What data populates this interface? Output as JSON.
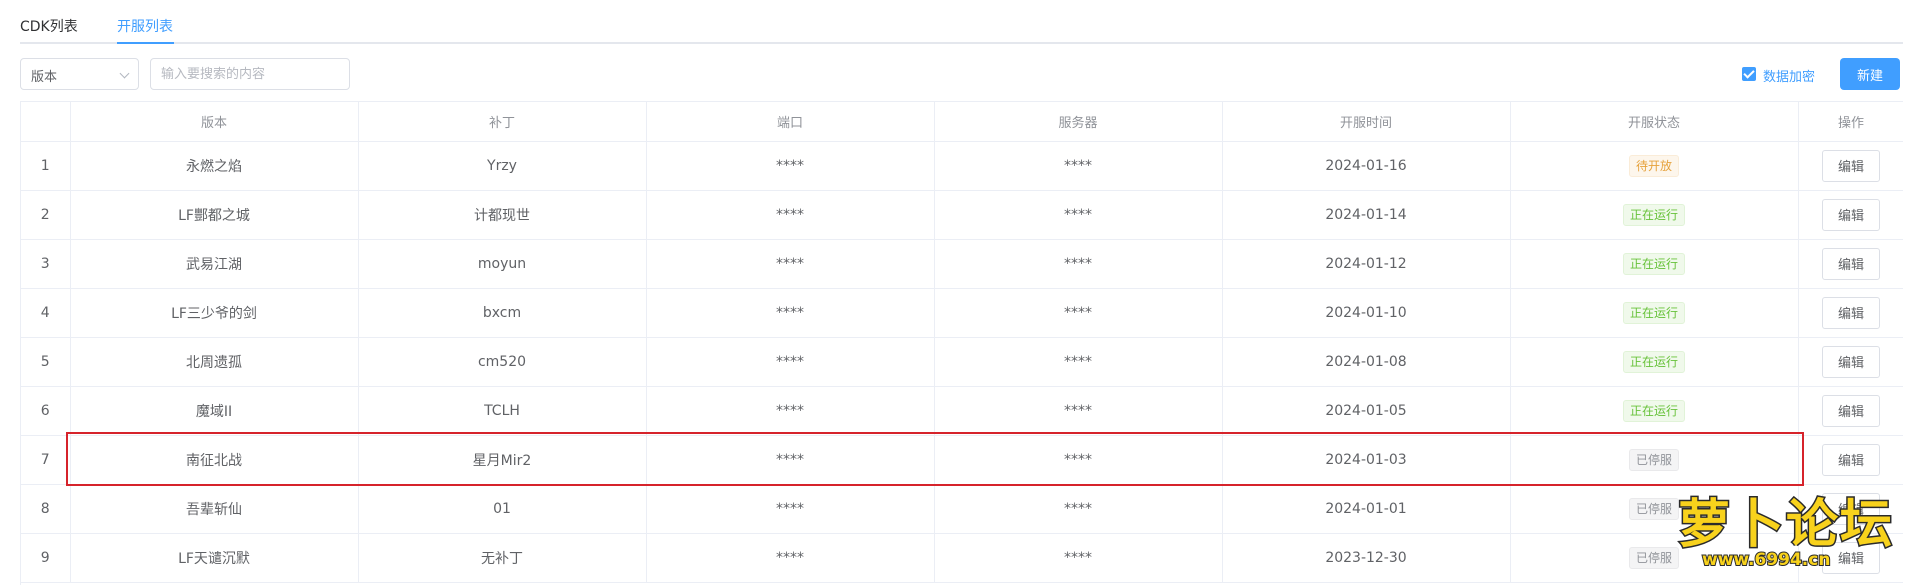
{
  "tabs": [
    {
      "label": "CDK列表",
      "active": false
    },
    {
      "label": "开服列表",
      "active": true
    }
  ],
  "toolbar": {
    "version_select": "版本",
    "search_placeholder": "输入要搜索的内容",
    "encrypt_label": "数据加密",
    "encrypt_checked": true,
    "new_button": "新建"
  },
  "table": {
    "headers": [
      "",
      "版本",
      "补丁",
      "端口",
      "服务器",
      "开服时间",
      "开服状态",
      "操作"
    ],
    "edit_label": "编辑",
    "rows": [
      {
        "index": "1",
        "version": "永燃之焰",
        "patch": "Yrzy",
        "port": "****",
        "server": "****",
        "date": "2024-01-16",
        "status": "待开放",
        "status_type": "warning"
      },
      {
        "index": "2",
        "version": "LF酆都之城",
        "patch": "计都现世",
        "port": "****",
        "server": "****",
        "date": "2024-01-14",
        "status": "正在运行",
        "status_type": "success"
      },
      {
        "index": "3",
        "version": "武易江湖",
        "patch": "moyun",
        "port": "****",
        "server": "****",
        "date": "2024-01-12",
        "status": "正在运行",
        "status_type": "success"
      },
      {
        "index": "4",
        "version": "LF三少爷的剑",
        "patch": "bxcm",
        "port": "****",
        "server": "****",
        "date": "2024-01-10",
        "status": "正在运行",
        "status_type": "success"
      },
      {
        "index": "5",
        "version": "北周遗孤",
        "patch": "cm520",
        "port": "****",
        "server": "****",
        "date": "2024-01-08",
        "status": "正在运行",
        "status_type": "success"
      },
      {
        "index": "6",
        "version": "魔域II",
        "patch": "TCLH",
        "port": "****",
        "server": "****",
        "date": "2024-01-05",
        "status": "正在运行",
        "status_type": "success"
      },
      {
        "index": "7",
        "version": "南征北战",
        "patch": "星月Mir2",
        "port": "****",
        "server": "****",
        "date": "2024-01-03",
        "status": "已停服",
        "status_type": "info"
      },
      {
        "index": "8",
        "version": "吾辈斩仙",
        "patch": "01",
        "port": "****",
        "server": "****",
        "date": "2024-01-01",
        "status": "已停服",
        "status_type": "info"
      },
      {
        "index": "9",
        "version": "LF天谴沉默",
        "patch": "无补丁",
        "port": "****",
        "server": "****",
        "date": "2023-12-30",
        "status": "已停服",
        "status_type": "info"
      }
    ]
  },
  "watermark": {
    "name": "萝卜论坛",
    "url": "www.6994.cn"
  },
  "colors": {
    "primary": "#409eff",
    "warning": "#e6a23c",
    "success": "#67c23a",
    "info": "#909399",
    "highlight": "#d6232b"
  }
}
